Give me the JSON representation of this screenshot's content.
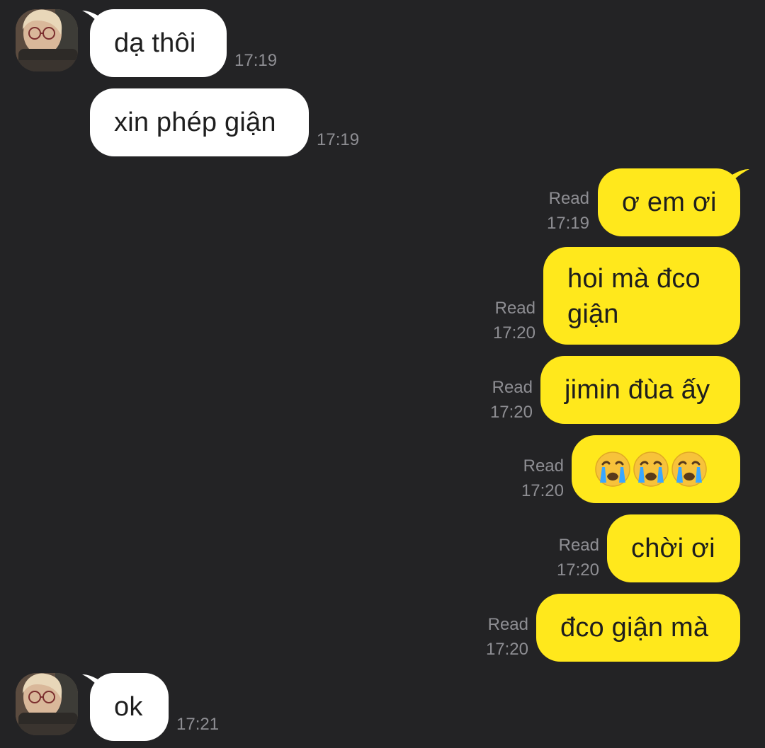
{
  "contact": {
    "avatar_icon": "profile-photo"
  },
  "messages": [
    {
      "id": "m1",
      "direction": "in",
      "text": "dạ thôi",
      "time": "17:19"
    },
    {
      "id": "m2",
      "direction": "in",
      "text": "xin phép giận",
      "time": "17:19"
    },
    {
      "id": "m3",
      "direction": "out",
      "text": "ơ em ơi",
      "status": "Read",
      "time": "17:19"
    },
    {
      "id": "m4",
      "direction": "out",
      "text_line1": "hoi mà đco",
      "text_line2": "giận",
      "status": "Read",
      "time": "17:20"
    },
    {
      "id": "m5",
      "direction": "out",
      "text": "jimin đùa ấy",
      "status": "Read",
      "time": "17:20"
    },
    {
      "id": "m6",
      "direction": "out",
      "emoji": [
        "😭",
        "😭",
        "😭"
      ],
      "emoji_name": "loudly-crying-face",
      "status": "Read",
      "time": "17:20"
    },
    {
      "id": "m7",
      "direction": "out",
      "text": "chời ơi",
      "status": "Read",
      "time": "17:20"
    },
    {
      "id": "m8",
      "direction": "out",
      "text": "đco giận mà",
      "status": "Read",
      "time": "17:20"
    },
    {
      "id": "m9",
      "direction": "in",
      "text": "ok",
      "time": "17:21"
    }
  ],
  "colors": {
    "background": "#232325",
    "incoming_bubble": "#ffffff",
    "outgoing_bubble": "#ffe81c",
    "meta_text": "#8e8e93"
  }
}
